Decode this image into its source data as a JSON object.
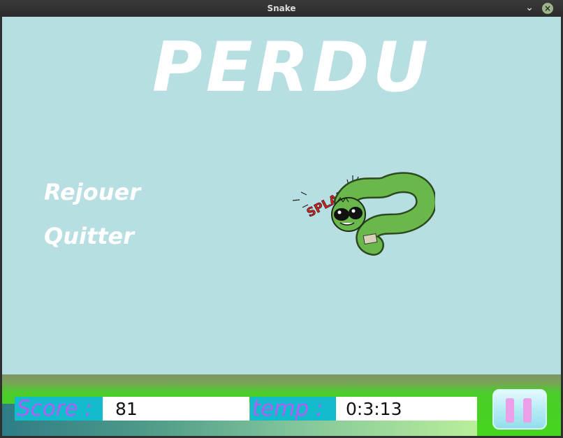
{
  "window": {
    "title": "Snake",
    "minimize_glyph": "⌄",
    "close_glyph": "×"
  },
  "game": {
    "headline": "PERDU",
    "menu": {
      "replay": "Rejouer",
      "quit": "Quitter"
    },
    "illustration": {
      "icon": "snake-squashed-illustration",
      "sound_text": "SPLAFF!"
    }
  },
  "status_bar": {
    "score_label": "Score :",
    "score_value": "81",
    "time_label": "temp :",
    "time_value": "0:3:13",
    "pause_icon": "pause-icon"
  },
  "colors": {
    "game_bg": "#b7dfe1",
    "label_bg": "#12bccd",
    "label_text": "#b25cf5",
    "status_green": "#45d51e",
    "snake_green": "#6ab84c"
  }
}
